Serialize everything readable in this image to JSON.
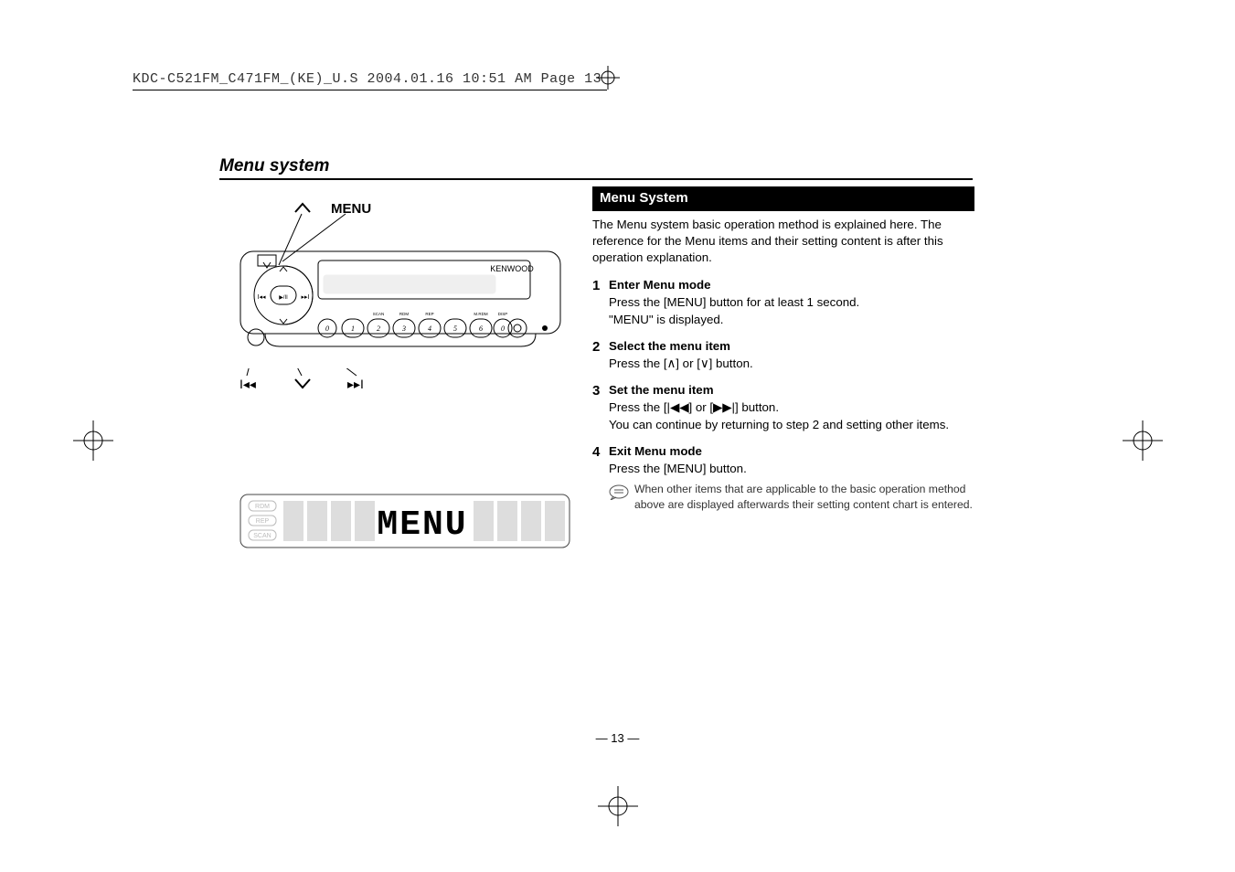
{
  "file_header": "KDC-C521FM_C471FM_(KE)_U.S  2004.01.16  10:51 AM  Page 13",
  "section_title": "Menu system",
  "callouts": {
    "menu_label": "MENU"
  },
  "radio": {
    "brand": "KENWOOD",
    "labels": {
      "scan": "SCAN",
      "rdm": "RDM",
      "rep": "REP",
      "mrdm": "M.RDM",
      "disp": "DISP"
    }
  },
  "lcd": {
    "text": "MENU",
    "indicators": [
      "RDM",
      "REP",
      "SCAN"
    ]
  },
  "right": {
    "heading": "Menu System",
    "intro": "The Menu system basic operation method is explained here. The reference for the Menu items and their setting content is after this operation explanation.",
    "steps": [
      {
        "num": "1",
        "title": "Enter Menu mode",
        "lines": [
          "Press the [MENU] button for at least 1 second.",
          "\"MENU\" is displayed."
        ]
      },
      {
        "num": "2",
        "title": "Select the menu item",
        "lines": [
          "Press the [∧] or [∨] button."
        ]
      },
      {
        "num": "3",
        "title": "Set the menu item",
        "lines": [
          "Press the [|◀◀] or [▶▶|] button.",
          "You can continue by returning to step 2 and setting other items."
        ]
      },
      {
        "num": "4",
        "title": "Exit Menu mode",
        "lines": [
          "Press the [MENU] button."
        ]
      }
    ],
    "note": "When other items that are applicable to the basic operation method above are displayed afterwards their setting content chart is entered."
  },
  "page_number": "— 13 —"
}
